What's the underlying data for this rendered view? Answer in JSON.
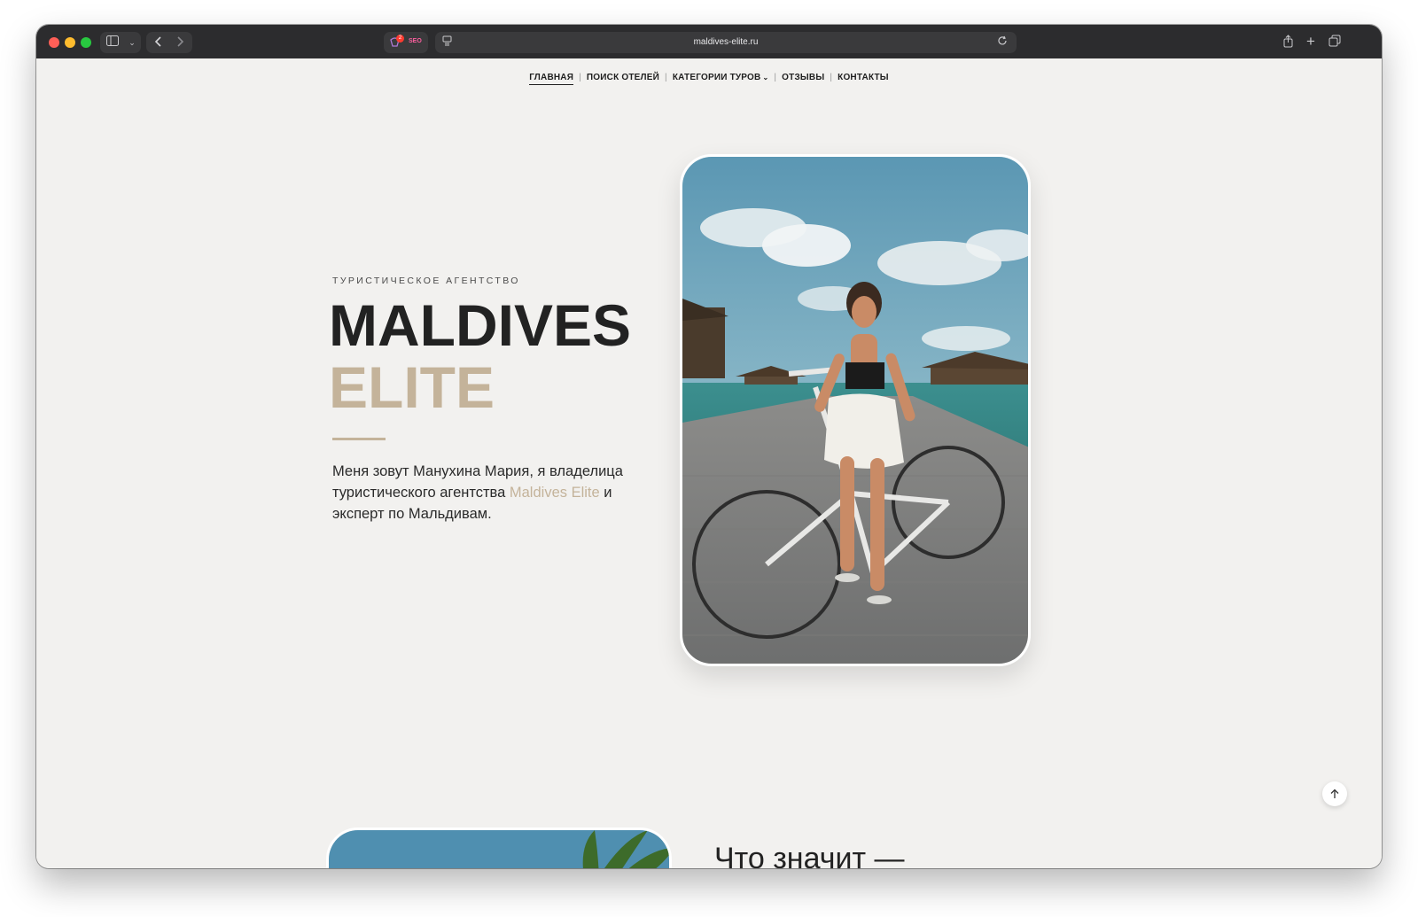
{
  "browser": {
    "url": "maldives-elite.ru",
    "extension_badge_count": "2",
    "extension_label": "SEO"
  },
  "nav": {
    "items": [
      {
        "label": "ГЛАВНАЯ"
      },
      {
        "label": "ПОИСК ОТЕЛЕЙ"
      },
      {
        "label": "КАТЕГОРИИ ТУРОВ"
      },
      {
        "label": "ОТЗЫВЫ"
      },
      {
        "label": "КОНТАКТЫ"
      }
    ]
  },
  "hero": {
    "eyebrow": "ТУРИСТИЧЕСКОЕ АГЕНТСТВО",
    "title_line1": "MALDIVES",
    "title_line2": "ELITE",
    "intro_before": "Меня зовут Манухина Мария, я владелица туристического агентства ",
    "intro_accent": "Maldives Elite",
    "intro_after": " и эксперт по Мальдивам."
  },
  "section2": {
    "title": "Что значит —"
  },
  "colors": {
    "accent": "#c4b39a",
    "page_bg": "#f2f1ef",
    "text": "#222222"
  },
  "icons": {
    "sidebar": "sidebar-icon",
    "back": "chevron-left-icon",
    "forward": "chevron-right-icon",
    "reload": "reload-icon",
    "share": "share-icon",
    "new_tab": "plus-icon",
    "tabs": "tabs-overview-icon",
    "scroll_top": "arrow-up-icon"
  }
}
